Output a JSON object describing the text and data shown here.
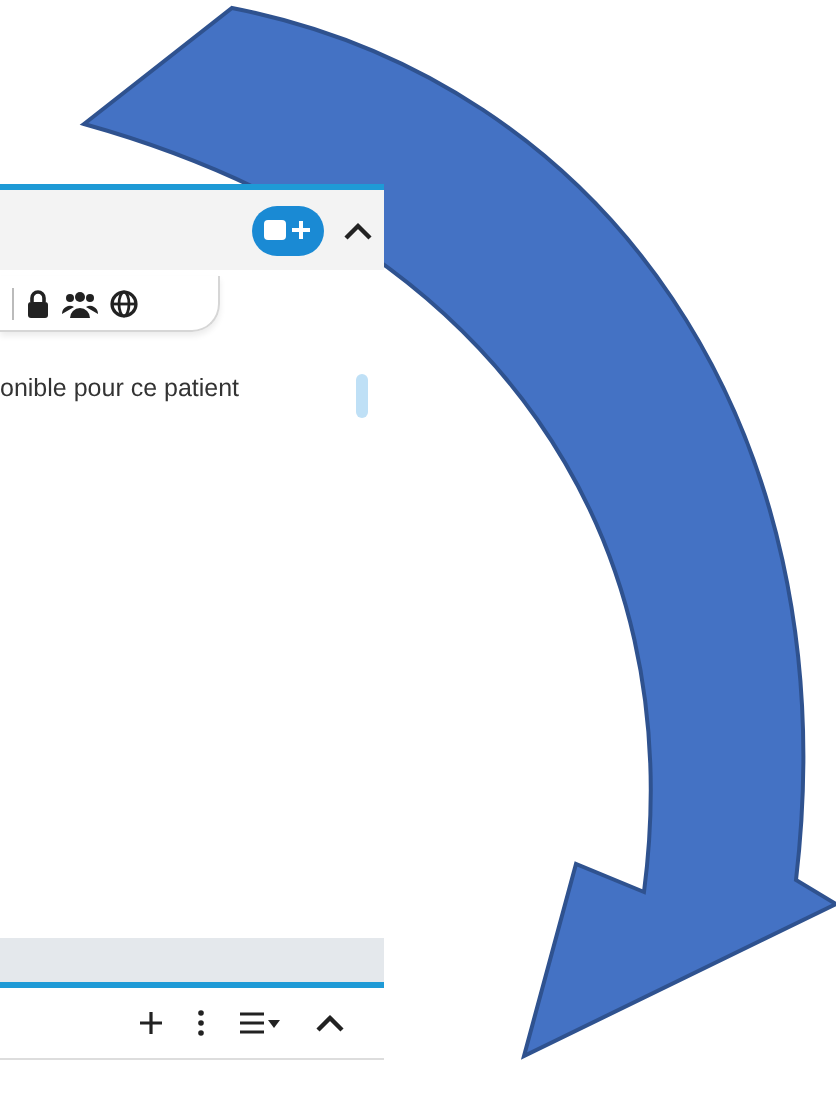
{
  "top_panel": {
    "message": "onible pour ce patient"
  }
}
